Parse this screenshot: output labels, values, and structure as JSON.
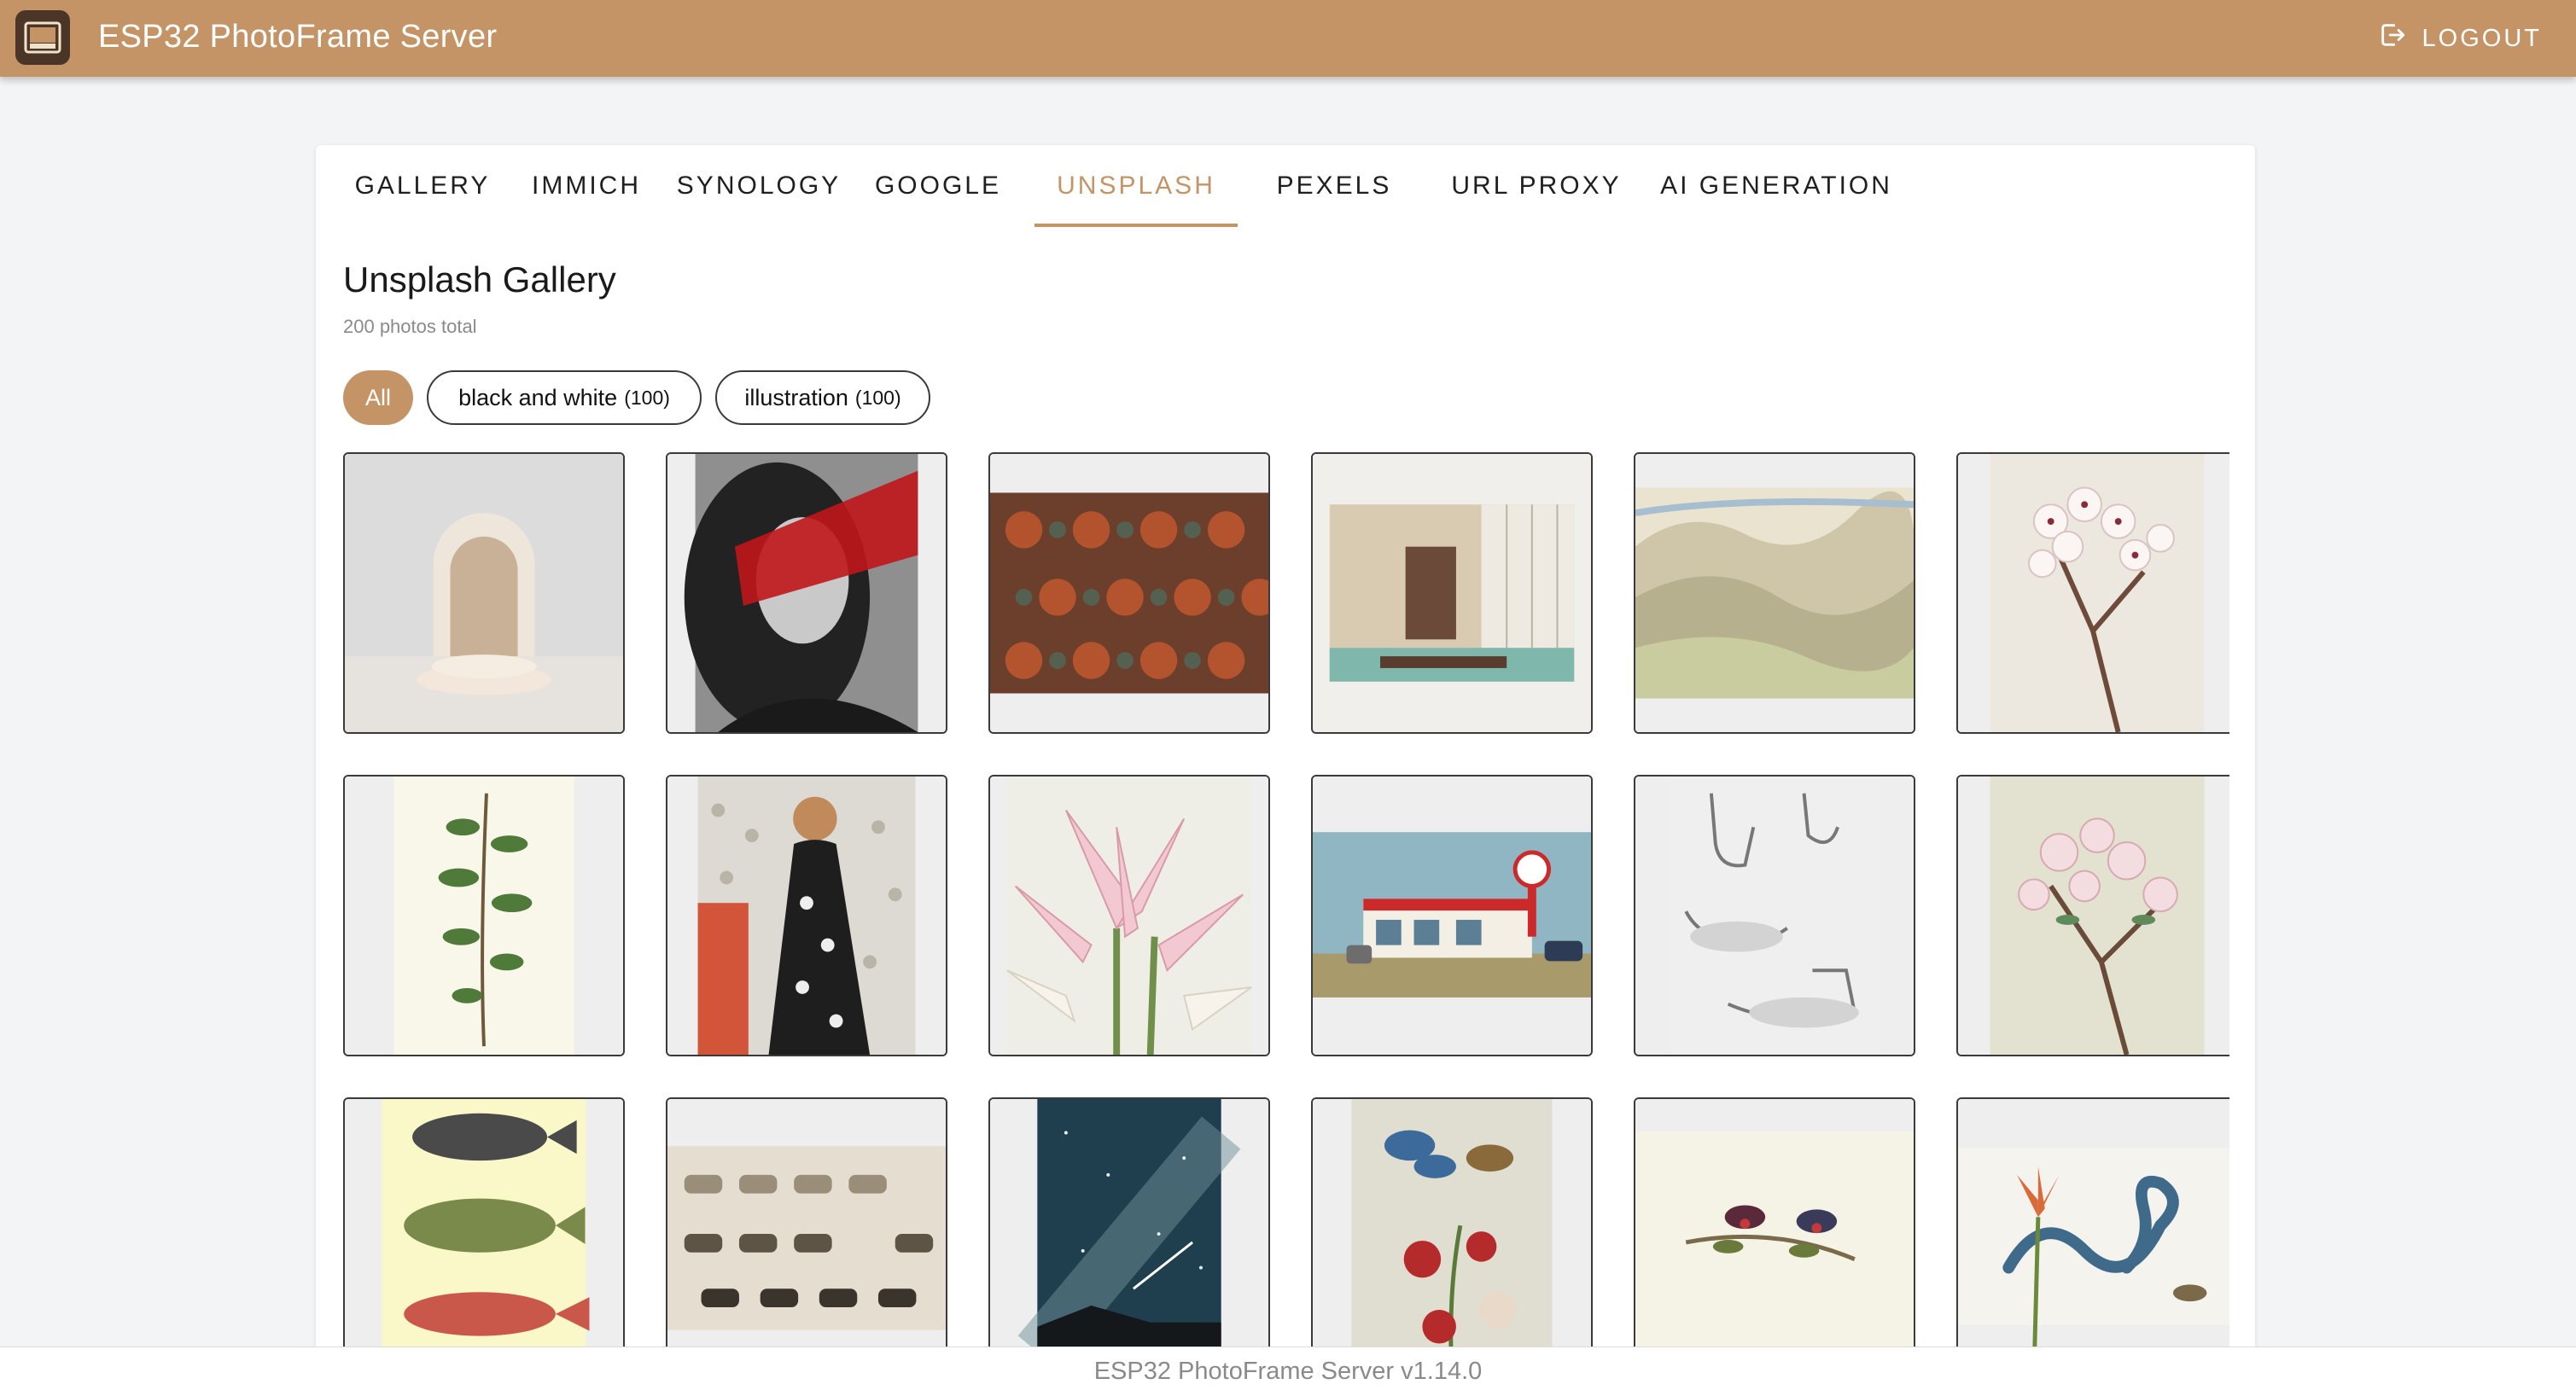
{
  "app": {
    "title": "ESP32 PhotoFrame Server",
    "logout_label": "LOGOUT",
    "accent": "#c49467"
  },
  "tabs": [
    {
      "label": "GALLERY",
      "active": false
    },
    {
      "label": "IMMICH",
      "active": false
    },
    {
      "label": "SYNOLOGY",
      "active": false
    },
    {
      "label": "GOOGLE",
      "active": false
    },
    {
      "label": "UNSPLASH",
      "active": true
    },
    {
      "label": "PEXELS",
      "active": false
    },
    {
      "label": "URL PROXY",
      "active": false
    },
    {
      "label": "AI GENERATION",
      "active": false
    }
  ],
  "gallery": {
    "title": "Unsplash Gallery",
    "count_text": "200 photos total",
    "filters": [
      {
        "label": "All",
        "count": "",
        "selected": true
      },
      {
        "label": "black and white",
        "count": "(100)",
        "selected": false
      },
      {
        "label": "illustration",
        "count": "(100)",
        "selected": false
      }
    ],
    "photos": [
      {
        "subject": "arched-doorway-3d-render"
      },
      {
        "subject": "woman-curly-hair-red-stripe"
      },
      {
        "subject": "floral-pattern-textile"
      },
      {
        "subject": "modern-interior-room"
      },
      {
        "subject": "mountain-landscape-watercolor"
      },
      {
        "subject": "cherry-blossom-branch"
      },
      {
        "subject": "botanical-green-branch"
      },
      {
        "subject": "art-deco-woman-illustration"
      },
      {
        "subject": "pink-lilies"
      },
      {
        "subject": "esso-gas-station-postcard"
      },
      {
        "subject": "foot-anatomy-sketches"
      },
      {
        "subject": "pink-blossom-branch"
      },
      {
        "subject": "fish-illustrations"
      },
      {
        "subject": "horses-study-sheet"
      },
      {
        "subject": "milky-way-night-sky"
      },
      {
        "subject": "butterflies-and-flowers"
      },
      {
        "subject": "sunbirds-on-branch"
      },
      {
        "subject": "snake-and-lily"
      }
    ]
  },
  "footer": {
    "text": "ESP32 PhotoFrame Server v1.14.0"
  }
}
